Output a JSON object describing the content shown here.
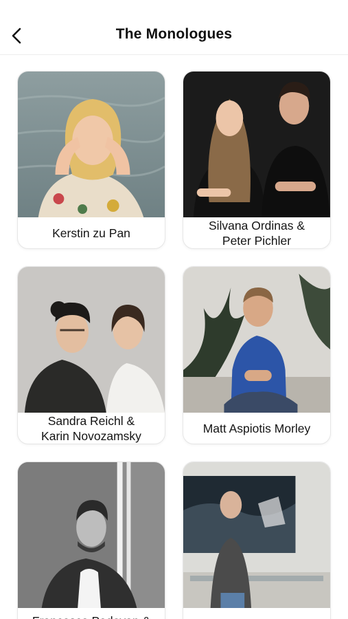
{
  "header": {
    "title": "The Monologues",
    "back_icon": "chevron-left-icon"
  },
  "cards": [
    {
      "name": "Kerstin zu Pan"
    },
    {
      "name": "Silvana Ordinas &\nPeter Pichler"
    },
    {
      "name": "Sandra Reichl &\nKarin Novozamsky"
    },
    {
      "name": "Matt Aspiotis Morley"
    },
    {
      "name": "Francesco Padovan &"
    },
    {
      "name": ""
    }
  ]
}
